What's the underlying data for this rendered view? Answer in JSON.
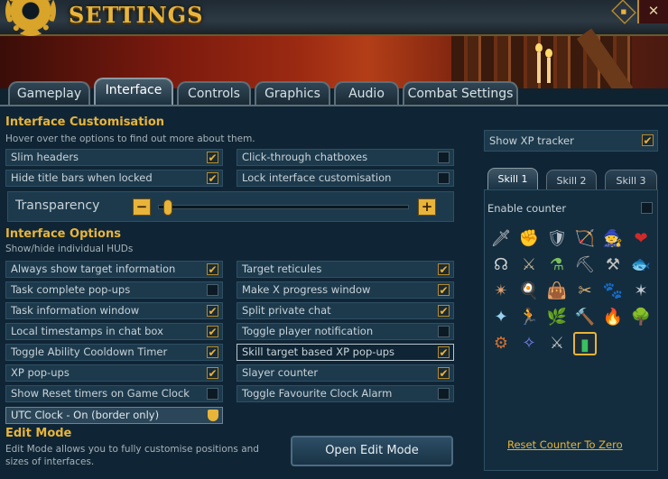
{
  "window": {
    "title": "SETTINGS",
    "close_icon": "✕",
    "flag_icon": "◆"
  },
  "tabs": [
    {
      "label": "Gameplay"
    },
    {
      "label": "Interface"
    },
    {
      "label": "Controls"
    },
    {
      "label": "Graphics"
    },
    {
      "label": "Audio"
    },
    {
      "label": "Combat Settings"
    }
  ],
  "customisation": {
    "title": "Interface Customisation",
    "description": "Hover over the options to find out more about them.",
    "options": [
      {
        "label": "Slim headers",
        "checked": true
      },
      {
        "label": "Click-through chatboxes",
        "checked": false
      },
      {
        "label": "Hide title bars when locked",
        "checked": true
      },
      {
        "label": "Lock interface customisation",
        "checked": false
      }
    ],
    "transparency": {
      "label": "Transparency",
      "minus": "−",
      "plus": "+",
      "value": 0
    }
  },
  "options": {
    "title": "Interface Options",
    "description": "Show/hide individual HUDs",
    "left": [
      {
        "label": "Always show target information",
        "checked": true
      },
      {
        "label": "Task complete pop-ups",
        "checked": false
      },
      {
        "label": "Task information window",
        "checked": true
      },
      {
        "label": "Local timestamps in chat box",
        "checked": true
      },
      {
        "label": "Toggle Ability Cooldown Timer",
        "checked": true
      },
      {
        "label": "XP pop-ups",
        "checked": true
      },
      {
        "label": "Show Reset timers on Game Clock",
        "checked": false
      }
    ],
    "right": [
      {
        "label": "Target reticules",
        "checked": true
      },
      {
        "label": "Make X progress window",
        "checked": true
      },
      {
        "label": "Split private chat",
        "checked": true
      },
      {
        "label": "Toggle player notification",
        "checked": false
      },
      {
        "label": "Skill target based XP pop-ups",
        "checked": true
      },
      {
        "label": "Slayer counter",
        "checked": true
      },
      {
        "label": "Toggle Favourite Clock Alarm",
        "checked": false
      }
    ],
    "clock_select": "UTC Clock - On (border only)"
  },
  "edit_mode": {
    "title": "Edit Mode",
    "description_1": "Edit Mode allows you to fully customise positions and",
    "description_2": "sizes of interfaces.",
    "button": "Open Edit Mode"
  },
  "xp_tracker": {
    "label": "Show XP tracker",
    "checked": true,
    "skill_tabs": [
      "Skill 1",
      "Skill 2",
      "Skill 3"
    ],
    "enable_counter": "Enable counter",
    "enable_counter_checked": false,
    "skills": [
      {
        "name": "attack-icon",
        "glyph": "🗡",
        "color": "#c9c9c9"
      },
      {
        "name": "strength-icon",
        "glyph": "✊",
        "color": "#e0a070"
      },
      {
        "name": "defence-icon",
        "glyph": "🛡",
        "color": "#b8c0c8"
      },
      {
        "name": "ranged-icon",
        "glyph": "🏹",
        "color": "#9ab070"
      },
      {
        "name": "magic-icon",
        "glyph": "🧙",
        "color": "#5a6ad0"
      },
      {
        "name": "constitution-icon",
        "glyph": "❤",
        "color": "#d02a2a"
      },
      {
        "name": "prayer-icon",
        "glyph": "☊",
        "color": "#d0d0d0"
      },
      {
        "name": "agility-icon",
        "glyph": "⚔",
        "color": "#c0b090"
      },
      {
        "name": "herblore-icon",
        "glyph": "⚗",
        "color": "#7ac05a"
      },
      {
        "name": "mining-icon",
        "glyph": "⛏",
        "color": "#a0a0a0"
      },
      {
        "name": "smithing-icon",
        "glyph": "⚒",
        "color": "#c0c0c0"
      },
      {
        "name": "fishing-icon",
        "glyph": "🐟",
        "color": "#8ab0d0"
      },
      {
        "name": "runecrafting-icon",
        "glyph": "✴",
        "color": "#e0a070"
      },
      {
        "name": "cooking-icon",
        "glyph": "🍳",
        "color": "#e0c090"
      },
      {
        "name": "thieving-icon",
        "glyph": "👜",
        "color": "#c0a080"
      },
      {
        "name": "crafting-icon",
        "glyph": "✂",
        "color": "#e0b070"
      },
      {
        "name": "hunter-icon",
        "glyph": "🐾",
        "color": "#d09050"
      },
      {
        "name": "summoning-icon",
        "glyph": "✶",
        "color": "#c0c8d0"
      },
      {
        "name": "divination-icon",
        "glyph": "✦",
        "color": "#9ad0f0"
      },
      {
        "name": "dungeoneering-icon",
        "glyph": "🏃",
        "color": "#e0a040"
      },
      {
        "name": "farming-icon",
        "glyph": "🌿",
        "color": "#60b040"
      },
      {
        "name": "construction-icon",
        "glyph": "🔨",
        "color": "#c07040"
      },
      {
        "name": "firemaking-icon",
        "glyph": "🔥",
        "color": "#f07020"
      },
      {
        "name": "woodcutting-icon",
        "glyph": "🌳",
        "color": "#5a9a3a"
      },
      {
        "name": "invention-icon",
        "glyph": "⚙",
        "color": "#d07030"
      },
      {
        "name": "archaeology-icon",
        "glyph": "✧",
        "color": "#7a80f0"
      },
      {
        "name": "slayer-icon",
        "glyph": "⚔",
        "color": "#c0c0c0"
      },
      {
        "name": "total-level-icon",
        "glyph": "▮",
        "color": "#3ac060"
      }
    ],
    "selected_skill": "total-level-icon",
    "reset": "Reset Counter To Zero"
  },
  "colors": {
    "accent": "#e8b43a",
    "panel": "#0f2535",
    "row": "#1d3a4d"
  }
}
